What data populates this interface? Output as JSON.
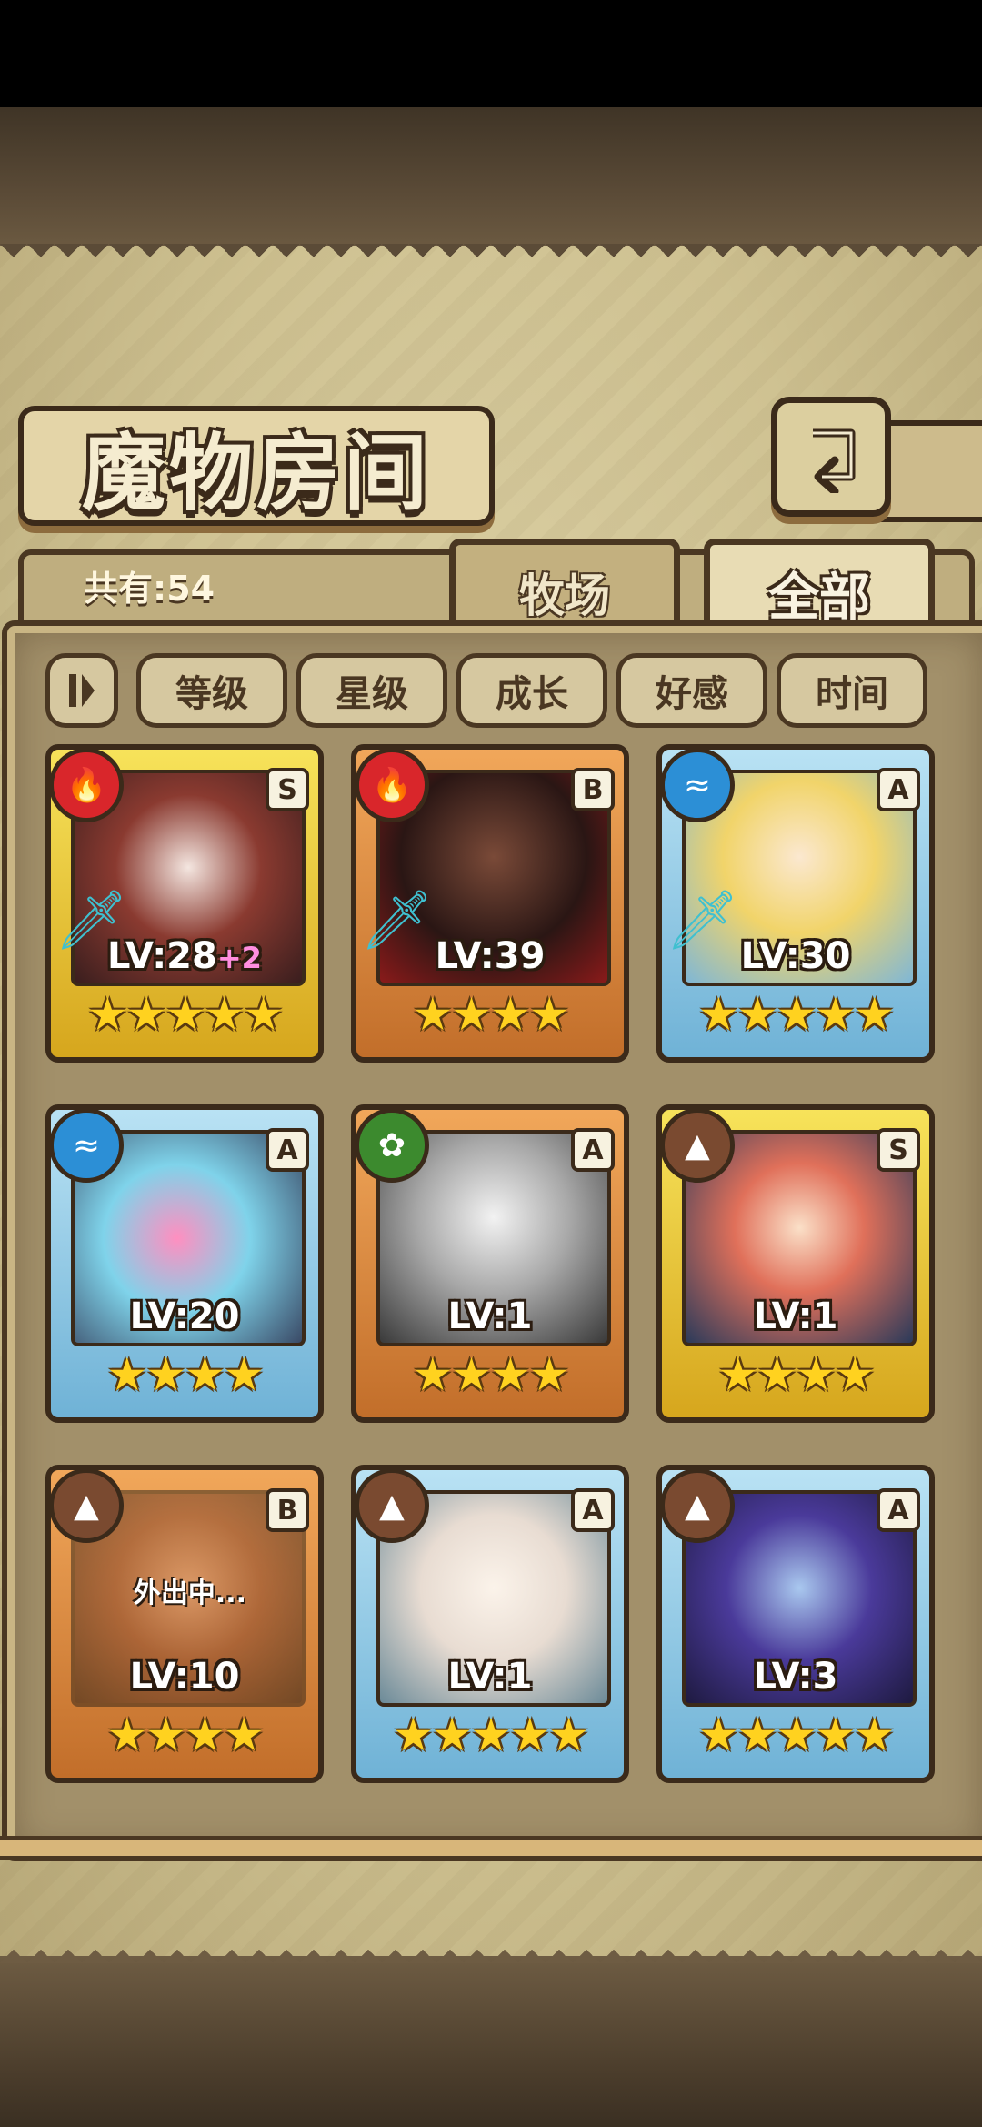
{
  "header": {
    "title": "魔物房间",
    "back_icon": "return-arrow-icon"
  },
  "summary": {
    "count_label": "共有:54"
  },
  "tabs": [
    {
      "label": "牧场",
      "active": false
    },
    {
      "label": "全部",
      "active": true
    }
  ],
  "sort_buttons": [
    {
      "label": "等级"
    },
    {
      "label": "星级"
    },
    {
      "label": "成长"
    },
    {
      "label": "好感"
    },
    {
      "label": "时间"
    }
  ],
  "sort_toggle_icon": "pause-sort-icon",
  "cards": [
    {
      "element": "fire",
      "element_color": "#d9262b",
      "rank": "S",
      "frame": "gold",
      "level": "LV:28",
      "bonus": "+2",
      "stars": "★★★★★",
      "equipped": true,
      "away": ""
    },
    {
      "element": "fire",
      "element_color": "#d9262b",
      "rank": "B",
      "frame": "bronze",
      "level": "LV:39",
      "bonus": "",
      "stars": "★★★★",
      "equipped": true,
      "away": ""
    },
    {
      "element": "water",
      "element_color": "#2c8fd6",
      "rank": "A",
      "frame": "blue",
      "level": "LV:30",
      "bonus": "",
      "stars": "★★★★★",
      "equipped": true,
      "away": ""
    },
    {
      "element": "water",
      "element_color": "#2c8fd6",
      "rank": "A",
      "frame": "blue",
      "level": "LV:20",
      "bonus": "",
      "stars": "★★★★",
      "equipped": false,
      "away": ""
    },
    {
      "element": "leaf",
      "element_color": "#3c8a2e",
      "rank": "A",
      "frame": "bronze",
      "level": "LV:1",
      "bonus": "",
      "stars": "★★★★",
      "equipped": false,
      "away": ""
    },
    {
      "element": "earth",
      "element_color": "#7a4a30",
      "rank": "S",
      "frame": "gold",
      "level": "LV:1",
      "bonus": "",
      "stars": "★★★★",
      "equipped": false,
      "away": ""
    },
    {
      "element": "earth",
      "element_color": "#7a4a30",
      "rank": "B",
      "frame": "bronze",
      "level": "LV:10",
      "bonus": "",
      "stars": "★★★★",
      "equipped": false,
      "away": "外出中..."
    },
    {
      "element": "earth",
      "element_color": "#7a4a30",
      "rank": "A",
      "frame": "blue",
      "level": "LV:1",
      "bonus": "",
      "stars": "★★★★★",
      "equipped": false,
      "away": ""
    },
    {
      "element": "earth",
      "element_color": "#7a4a30",
      "rank": "A",
      "frame": "blue",
      "level": "LV:3",
      "bonus": "",
      "stars": "★★★★★",
      "equipped": false,
      "away": ""
    }
  ]
}
